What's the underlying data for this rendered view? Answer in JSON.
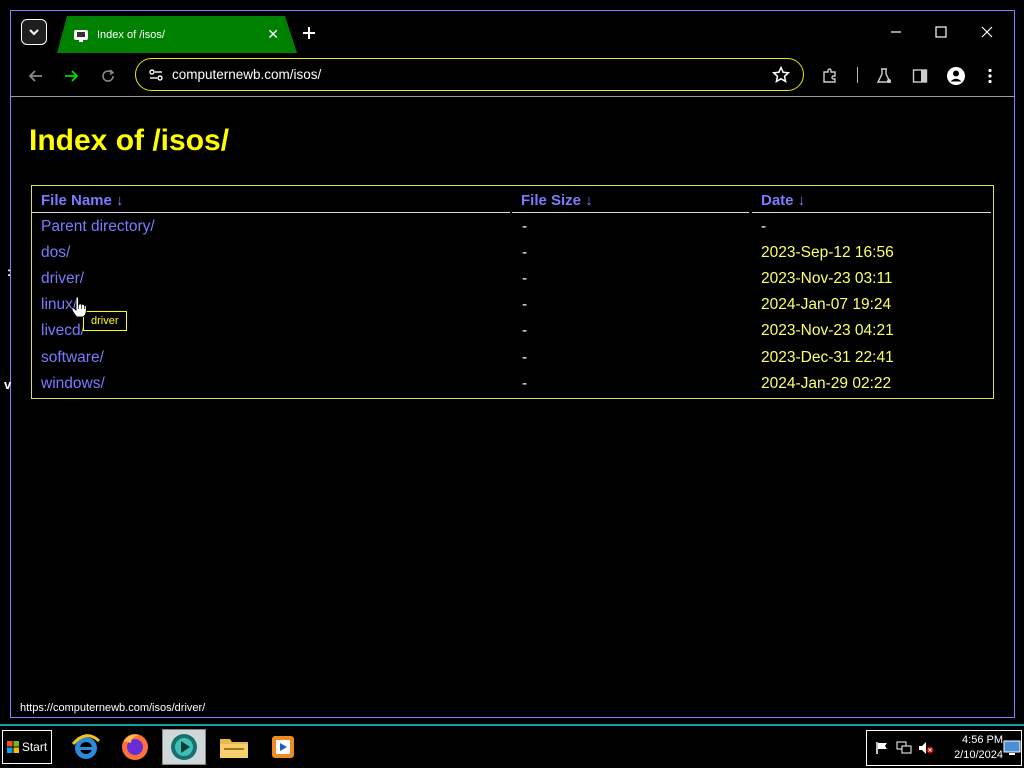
{
  "browser": {
    "tab": {
      "title": "Index of /isos/",
      "close_label": "✕"
    },
    "new_tab_label": "+",
    "address": "computernewb.com/isos/",
    "status_url": "https://computernewb.com/isos/driver/"
  },
  "page": {
    "title": "Index of /isos/",
    "columns": {
      "name": "File Name  ↓",
      "size": "File Size  ↓",
      "date": "Date  ↓"
    },
    "rows": [
      {
        "name": "Parent directory/",
        "size": "-",
        "date": "-"
      },
      {
        "name": "dos/",
        "size": "-",
        "date": "2023-Sep-12 16:56"
      },
      {
        "name": "driver/",
        "size": "-",
        "date": "2023-Nov-23 03:11"
      },
      {
        "name": "linux/",
        "size": "-",
        "date": "2024-Jan-07 19:24"
      },
      {
        "name": "livecd/",
        "size": "-",
        "date": "2023-Nov-23 04:21"
      },
      {
        "name": "software/",
        "size": "-",
        "date": "2023-Dec-31 22:41"
      },
      {
        "name": "windows/",
        "size": "-",
        "date": "2024-Jan-29 02:22"
      }
    ],
    "tooltip": "driver"
  },
  "taskbar": {
    "start_label": "Start",
    "clock_time": "4:56 PM",
    "clock_date": "2/10/2024",
    "apps": [
      "internet-explorer",
      "firefox",
      "media-center",
      "file-explorer",
      "media-player"
    ]
  },
  "colors": {
    "title": "#ffff00",
    "link": "#7b7bff",
    "date": "#ffff6a",
    "tab_active": "#008000",
    "omnibox_border": "#e8e800",
    "taskbar_border": "#0aa3a3"
  }
}
